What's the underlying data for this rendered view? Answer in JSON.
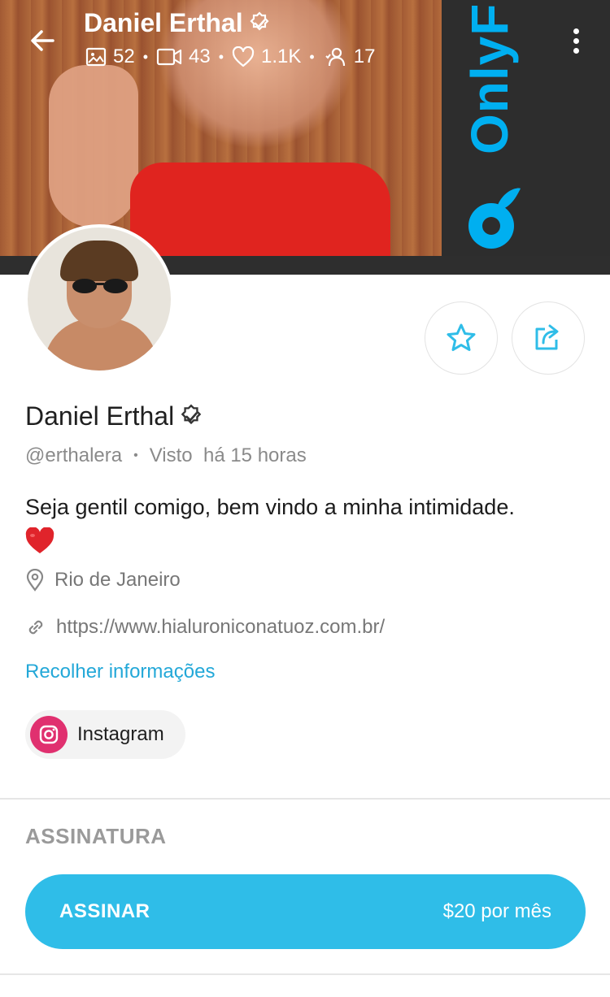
{
  "header": {
    "name": "Daniel Erthal",
    "stats": {
      "photos": "52",
      "videos": "43",
      "likes": "1.1K",
      "streams": "17"
    },
    "brand": "OnlyF"
  },
  "profile": {
    "name": "Daniel Erthal",
    "handle": "@erthalera",
    "last_seen_label": "Visto",
    "last_seen_value": "há 15 horas",
    "bio": "Seja gentil comigo, bem vindo a minha intimidade.",
    "location": "Rio de Janeiro",
    "website": "https://www.hialuroniconatuoz.com.br/",
    "collapse_link": "Recolher informações",
    "social": {
      "instagram_label": "Instagram"
    }
  },
  "subscription": {
    "section_title": "ASSINATURA",
    "button_label": "ASSINAR",
    "price": "$20 por mês"
  },
  "colors": {
    "accent": "#2fbde8",
    "link": "#23a8d8",
    "instagram": "#e0306f",
    "brand_blue": "#00aff0"
  },
  "icons": {
    "back": "arrow-left-icon",
    "verified": "verified-badge-icon",
    "photo": "image-icon",
    "video": "video-icon",
    "like": "heart-icon",
    "menu": "more-vertical-icon",
    "favorite": "star-icon",
    "share": "share-icon",
    "location": "map-pin-icon",
    "link": "link-icon",
    "instagram": "instagram-icon"
  }
}
